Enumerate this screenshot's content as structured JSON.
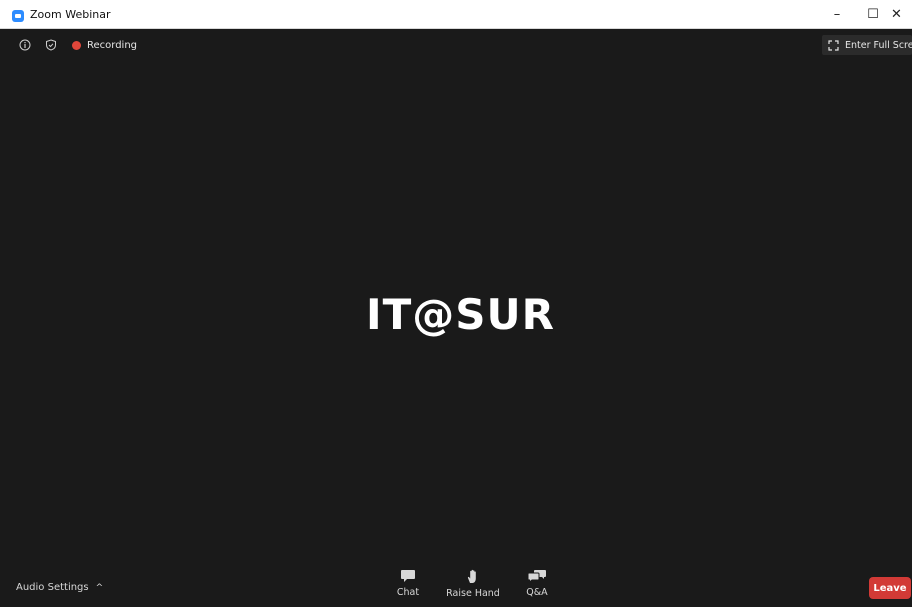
{
  "window": {
    "title": "Zoom Webinar",
    "minimize_glyph": "–",
    "maximize_glyph": "☐",
    "close_glyph": "✕"
  },
  "meeting": {
    "recording_label": "Recording",
    "fullscreen_label": "Enter Full Screen",
    "shared_content_text": "IT@SUR"
  },
  "toolbar": {
    "audio_settings_label": "Audio Settings",
    "audio_caret": "^",
    "items": [
      {
        "label": "Chat",
        "icon": "chat-icon"
      },
      {
        "label": "Raise Hand",
        "icon": "raise-hand-icon"
      },
      {
        "label": "Q&A",
        "icon": "qa-icon"
      }
    ],
    "leave_label": "Leave"
  },
  "colors": {
    "background": "#1a1a1a",
    "accent_blue": "#2d8cff",
    "recording_red": "#e0463a",
    "leave_red": "#d23a36"
  }
}
